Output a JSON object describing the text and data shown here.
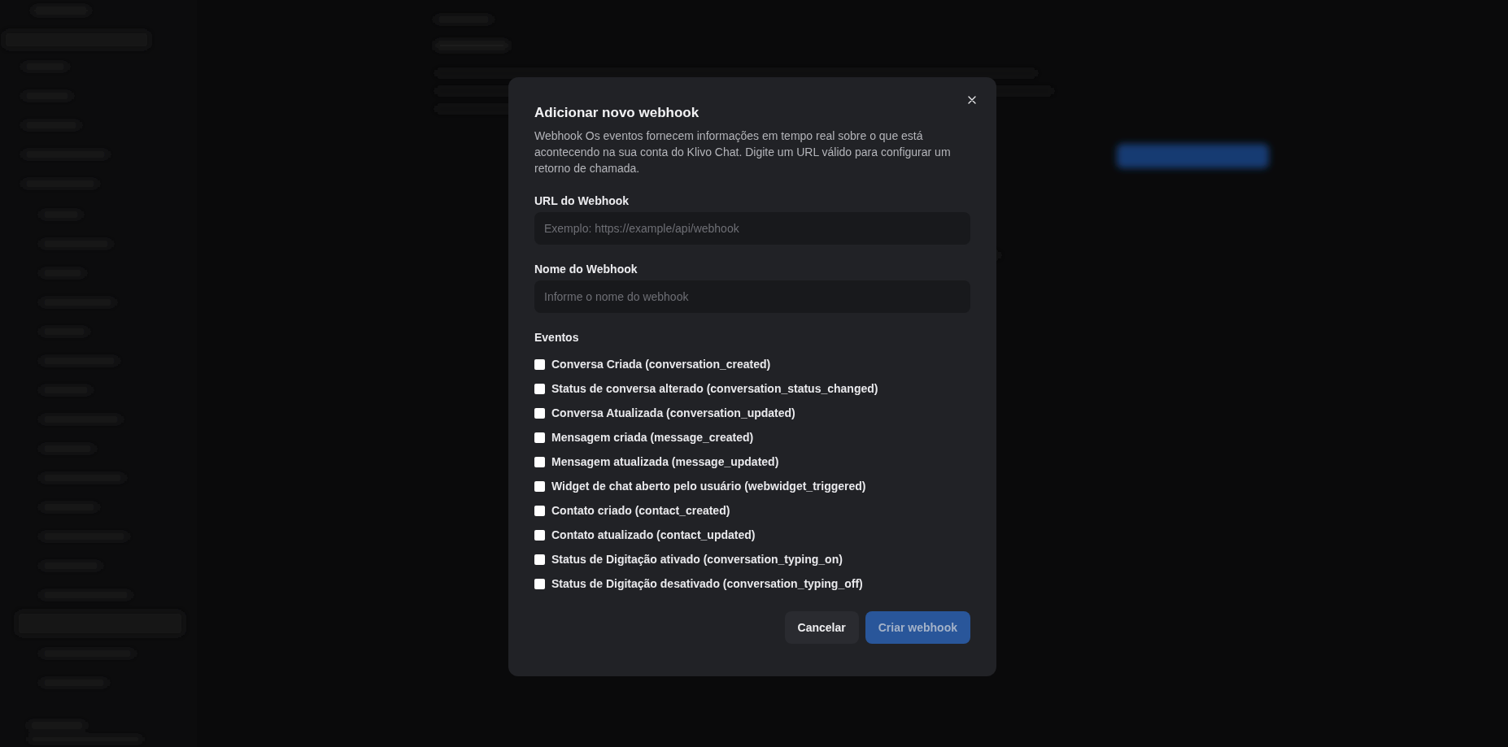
{
  "dialog": {
    "title": "Adicionar novo webhook",
    "description": "Webhook Os eventos fornecem informações em tempo real sobre o que está acontecendo na sua conta do Klivo Chat. Digite um URL válido para configurar um retorno de chamada."
  },
  "fields": [
    {
      "label": "URL do Webhook",
      "placeholder": "Exemplo: https://example/api/webhook"
    },
    {
      "label": "Nome do Webhook",
      "placeholder": "Informe o nome do webhook"
    }
  ],
  "events": {
    "label": "Eventos",
    "items": [
      {
        "label": "Conversa Criada (conversation_created)",
        "checked": false
      },
      {
        "label": "Status de conversa alterado (conversation_status_changed)",
        "checked": false
      },
      {
        "label": "Conversa Atualizada (conversation_updated)",
        "checked": false
      },
      {
        "label": "Mensagem criada (message_created)",
        "checked": false
      },
      {
        "label": "Mensagem atualizada (message_updated)",
        "checked": false
      },
      {
        "label": "Widget de chat aberto pelo usuário (webwidget_triggered)",
        "checked": false
      },
      {
        "label": "Contato criado (contact_created)",
        "checked": false
      },
      {
        "label": "Contato atualizado (contact_updated)",
        "checked": false
      },
      {
        "label": "Status de Digitação ativado (conversation_typing_on)",
        "checked": false
      },
      {
        "label": "Status de Digitação desativado (conversation_typing_off)",
        "checked": false
      }
    ]
  },
  "buttons": [
    {
      "label": "Cancelar",
      "kind": "secondary",
      "disabled": false
    },
    {
      "label": "Criar webhook",
      "kind": "primary",
      "disabled": true
    }
  ]
}
